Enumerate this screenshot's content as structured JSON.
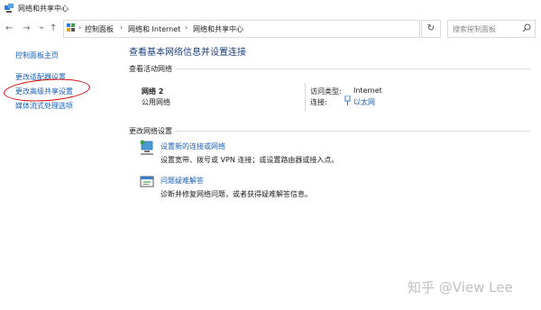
{
  "window": {
    "title": "网络和共享中心",
    "icon": "network-center-icon"
  },
  "nav": {
    "back": "←",
    "forward": "→",
    "recent": "⌄",
    "up": "↑",
    "refresh": "↻",
    "dropdown": "⌄"
  },
  "breadcrumb": {
    "sep": "›",
    "items": [
      "控制面板",
      "网络和 Internet",
      "网络和共享中心"
    ]
  },
  "search": {
    "placeholder": "搜索控制面板"
  },
  "sidebar": {
    "items": [
      {
        "label": "控制面板主页"
      },
      {
        "label": "更改适配器设置"
      },
      {
        "label": "更改高级共享设置"
      },
      {
        "label": "媒体流式处理选项"
      }
    ]
  },
  "main": {
    "heading": "查看基本网络信息并设置连接",
    "active_section": "查看活动网络",
    "network": {
      "name": "网络 2",
      "type": "公用网络",
      "access_label": "访问类型:",
      "access_value": "Internet",
      "conn_label": "连接:",
      "conn_value": "以太网"
    },
    "change_section": "更改网络设置",
    "tasks": [
      {
        "title": "设置新的连接或网络",
        "desc": "设置宽带、拨号或 VPN 连接；或设置路由器或接入点。",
        "icon": "new-connection-icon"
      },
      {
        "title": "问题疑难解答",
        "desc": "诊断并修复网络问题，或者获得疑难解答信息。",
        "icon": "troubleshoot-icon"
      }
    ]
  },
  "watermark": "知乎 @View Lee",
  "colors": {
    "link": "#1a5fb4",
    "heading": "#1a3f7a",
    "annotation": "#d40000"
  }
}
